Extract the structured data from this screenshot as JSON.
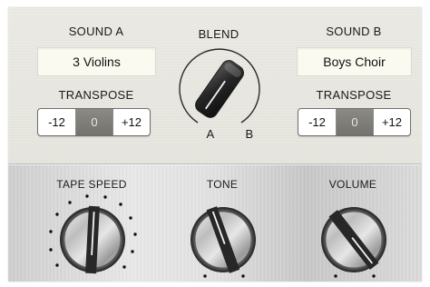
{
  "sound_a": {
    "label": "SOUND  A",
    "value": "3 Violins",
    "transpose_label": "TRANSPOSE",
    "transpose": {
      "minus": "-12",
      "value": "0",
      "plus": "+12"
    }
  },
  "sound_b": {
    "label": "SOUND  B",
    "value": "Boys Choir",
    "transpose_label": "TRANSPOSE",
    "transpose": {
      "minus": "-12",
      "value": "0",
      "plus": "+12"
    }
  },
  "blend": {
    "label": "BLEND",
    "left": "A",
    "right": "B"
  },
  "knobs": {
    "tape_speed": {
      "label": "TAPE SPEED"
    },
    "tone": {
      "label": "TONE"
    },
    "volume": {
      "label": "VOLUME"
    }
  },
  "colors": {
    "top_panel": "#e9e8e1",
    "sound_field": "#fbfaf0",
    "stepper_selected": "#807e78",
    "knob_stripe": "#2b2b2b"
  }
}
